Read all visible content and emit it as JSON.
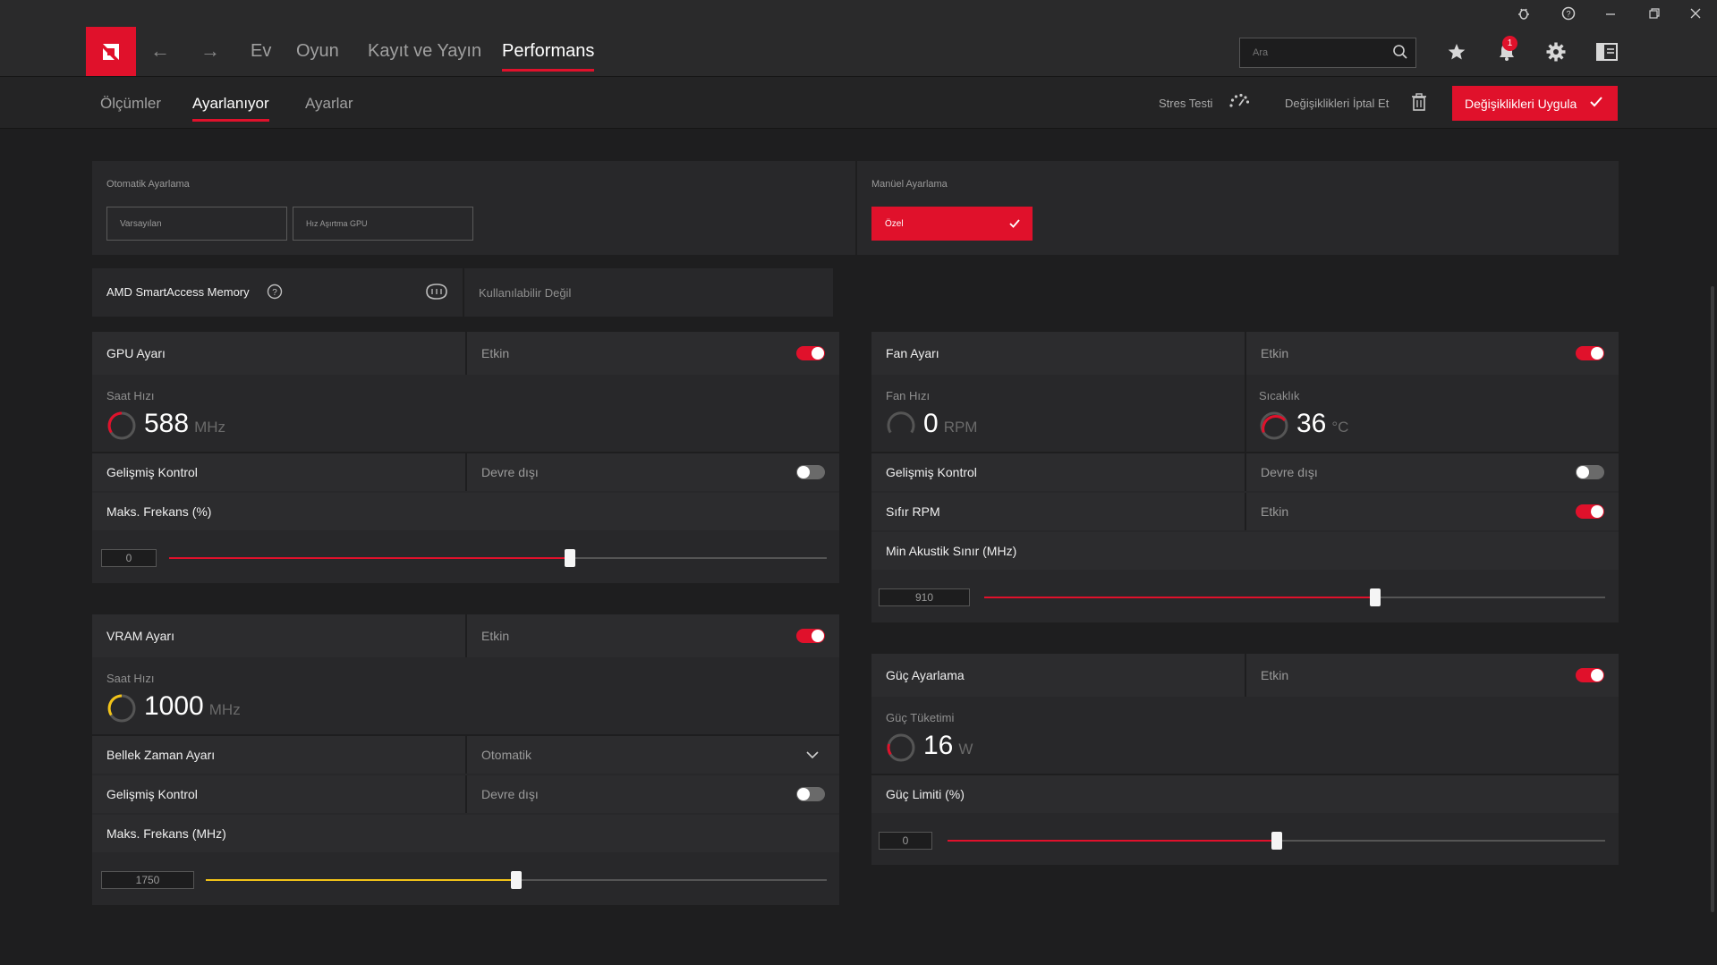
{
  "window": {
    "controls": [
      "bug-icon",
      "help-icon",
      "minimize-icon",
      "restore-icon",
      "close-icon"
    ]
  },
  "nav": {
    "back": "←",
    "forward": "→",
    "items": [
      "Ev",
      "Oyun",
      "Kayıt ve Yayın",
      "Performans"
    ],
    "active": "Performans",
    "search_placeholder": "Ara",
    "notification_count": "1"
  },
  "subnav": {
    "tabs": [
      "Ölçümler",
      "Ayarlanıyor",
      "Ayarlar"
    ],
    "active": "Ayarlanıyor",
    "stress_test": "Stres Testi",
    "discard": "Değişiklikleri İptal Et",
    "apply": "Değişiklikleri Uygula"
  },
  "presets": {
    "auto_label": "Otomatik Ayarlama",
    "auto_options": [
      "Varsayılan",
      "Hız Aşırtma GPU"
    ],
    "manual_label": "Manüel Ayarlama",
    "manual_option": "Özel"
  },
  "sam": {
    "label": "AMD SmartAccess Memory",
    "status": "Kullanılabilir Değil"
  },
  "gpu": {
    "title": "GPU Ayarı",
    "state": "Etkin",
    "enabled": true,
    "clock_label": "Saat Hızı",
    "clock_value": "588",
    "clock_unit": "MHz",
    "adv_label": "Gelişmiş Kontrol",
    "adv_state": "Devre dışı",
    "adv_enabled": false,
    "maxfreq_label": "Maks. Frekans (%)",
    "maxfreq_value": "0",
    "maxfreq_fraction": 0.61
  },
  "vram": {
    "title": "VRAM Ayarı",
    "state": "Etkin",
    "enabled": true,
    "clock_label": "Saat Hızı",
    "clock_value": "1000",
    "clock_unit": "MHz",
    "timing_label": "Bellek Zaman Ayarı",
    "timing_value": "Otomatik",
    "adv_label": "Gelişmiş Kontrol",
    "adv_state": "Devre dışı",
    "adv_enabled": false,
    "maxfreq_label": "Maks. Frekans (MHz)",
    "maxfreq_value": "1750",
    "maxfreq_fraction": 0.5
  },
  "fan": {
    "title": "Fan Ayarı",
    "state": "Etkin",
    "enabled": true,
    "speed_label": "Fan Hızı",
    "speed_value": "0",
    "speed_unit": "RPM",
    "temp_label": "Sıcaklık",
    "temp_value": "36",
    "temp_unit": "°C",
    "adv_label": "Gelişmiş Kontrol",
    "adv_state": "Devre dışı",
    "adv_enabled": false,
    "zero_rpm_label": "Sıfır RPM",
    "zero_rpm_state": "Etkin",
    "zero_rpm_enabled": true,
    "acoustic_label": "Min Akustik Sınır (MHz)",
    "acoustic_value": "910",
    "acoustic_fraction": 0.63
  },
  "power": {
    "title": "Güç Ayarlama",
    "state": "Etkin",
    "enabled": true,
    "usage_label": "Güç Tüketimi",
    "usage_value": "16",
    "usage_unit": "W",
    "limit_label": "Güç Limiti (%)",
    "limit_value": "0",
    "limit_fraction": 0.5
  },
  "colors": {
    "accent": "#e0112b",
    "vram_accent": "#f2c318",
    "background": "#1e1e1f"
  }
}
